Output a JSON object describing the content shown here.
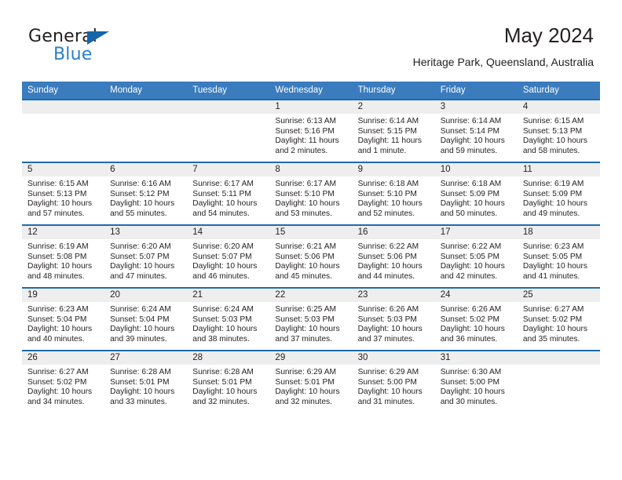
{
  "brand": {
    "word_one": "General",
    "word_two": "Blue",
    "triangle_color": "#1565a8",
    "blue_color": "#2a7fc9"
  },
  "header": {
    "title": "May 2024",
    "subtitle": "Heritage Park, Queensland, Australia"
  },
  "theme": {
    "header_bar": "#3a7cbe",
    "row_rule": "#1f6bb0",
    "daynum_band": "#eeeeee",
    "text": "#231f20"
  },
  "weekday_headers": [
    "Sunday",
    "Monday",
    "Tuesday",
    "Wednesday",
    "Thursday",
    "Friday",
    "Saturday"
  ],
  "labels": {
    "sunrise_prefix": "Sunrise:",
    "sunset_prefix": "Sunset:",
    "daylight_prefix": "Daylight:"
  },
  "weeks": [
    [
      {
        "day": "",
        "sunrise": "",
        "sunset": "",
        "daylight": "",
        "empty": true
      },
      {
        "day": "",
        "sunrise": "",
        "sunset": "",
        "daylight": "",
        "empty": true
      },
      {
        "day": "",
        "sunrise": "",
        "sunset": "",
        "daylight": "",
        "empty": true
      },
      {
        "day": "1",
        "sunrise": "Sunrise: 6:13 AM",
        "sunset": "Sunset: 5:16 PM",
        "daylight": "Daylight: 11 hours and 2 minutes."
      },
      {
        "day": "2",
        "sunrise": "Sunrise: 6:14 AM",
        "sunset": "Sunset: 5:15 PM",
        "daylight": "Daylight: 11 hours and 1 minute."
      },
      {
        "day": "3",
        "sunrise": "Sunrise: 6:14 AM",
        "sunset": "Sunset: 5:14 PM",
        "daylight": "Daylight: 10 hours and 59 minutes."
      },
      {
        "day": "4",
        "sunrise": "Sunrise: 6:15 AM",
        "sunset": "Sunset: 5:13 PM",
        "daylight": "Daylight: 10 hours and 58 minutes."
      }
    ],
    [
      {
        "day": "5",
        "sunrise": "Sunrise: 6:15 AM",
        "sunset": "Sunset: 5:13 PM",
        "daylight": "Daylight: 10 hours and 57 minutes."
      },
      {
        "day": "6",
        "sunrise": "Sunrise: 6:16 AM",
        "sunset": "Sunset: 5:12 PM",
        "daylight": "Daylight: 10 hours and 55 minutes."
      },
      {
        "day": "7",
        "sunrise": "Sunrise: 6:17 AM",
        "sunset": "Sunset: 5:11 PM",
        "daylight": "Daylight: 10 hours and 54 minutes."
      },
      {
        "day": "8",
        "sunrise": "Sunrise: 6:17 AM",
        "sunset": "Sunset: 5:10 PM",
        "daylight": "Daylight: 10 hours and 53 minutes."
      },
      {
        "day": "9",
        "sunrise": "Sunrise: 6:18 AM",
        "sunset": "Sunset: 5:10 PM",
        "daylight": "Daylight: 10 hours and 52 minutes."
      },
      {
        "day": "10",
        "sunrise": "Sunrise: 6:18 AM",
        "sunset": "Sunset: 5:09 PM",
        "daylight": "Daylight: 10 hours and 50 minutes."
      },
      {
        "day": "11",
        "sunrise": "Sunrise: 6:19 AM",
        "sunset": "Sunset: 5:09 PM",
        "daylight": "Daylight: 10 hours and 49 minutes."
      }
    ],
    [
      {
        "day": "12",
        "sunrise": "Sunrise: 6:19 AM",
        "sunset": "Sunset: 5:08 PM",
        "daylight": "Daylight: 10 hours and 48 minutes."
      },
      {
        "day": "13",
        "sunrise": "Sunrise: 6:20 AM",
        "sunset": "Sunset: 5:07 PM",
        "daylight": "Daylight: 10 hours and 47 minutes."
      },
      {
        "day": "14",
        "sunrise": "Sunrise: 6:20 AM",
        "sunset": "Sunset: 5:07 PM",
        "daylight": "Daylight: 10 hours and 46 minutes."
      },
      {
        "day": "15",
        "sunrise": "Sunrise: 6:21 AM",
        "sunset": "Sunset: 5:06 PM",
        "daylight": "Daylight: 10 hours and 45 minutes."
      },
      {
        "day": "16",
        "sunrise": "Sunrise: 6:22 AM",
        "sunset": "Sunset: 5:06 PM",
        "daylight": "Daylight: 10 hours and 44 minutes."
      },
      {
        "day": "17",
        "sunrise": "Sunrise: 6:22 AM",
        "sunset": "Sunset: 5:05 PM",
        "daylight": "Daylight: 10 hours and 42 minutes."
      },
      {
        "day": "18",
        "sunrise": "Sunrise: 6:23 AM",
        "sunset": "Sunset: 5:05 PM",
        "daylight": "Daylight: 10 hours and 41 minutes."
      }
    ],
    [
      {
        "day": "19",
        "sunrise": "Sunrise: 6:23 AM",
        "sunset": "Sunset: 5:04 PM",
        "daylight": "Daylight: 10 hours and 40 minutes."
      },
      {
        "day": "20",
        "sunrise": "Sunrise: 6:24 AM",
        "sunset": "Sunset: 5:04 PM",
        "daylight": "Daylight: 10 hours and 39 minutes."
      },
      {
        "day": "21",
        "sunrise": "Sunrise: 6:24 AM",
        "sunset": "Sunset: 5:03 PM",
        "daylight": "Daylight: 10 hours and 38 minutes."
      },
      {
        "day": "22",
        "sunrise": "Sunrise: 6:25 AM",
        "sunset": "Sunset: 5:03 PM",
        "daylight": "Daylight: 10 hours and 37 minutes."
      },
      {
        "day": "23",
        "sunrise": "Sunrise: 6:26 AM",
        "sunset": "Sunset: 5:03 PM",
        "daylight": "Daylight: 10 hours and 37 minutes."
      },
      {
        "day": "24",
        "sunrise": "Sunrise: 6:26 AM",
        "sunset": "Sunset: 5:02 PM",
        "daylight": "Daylight: 10 hours and 36 minutes."
      },
      {
        "day": "25",
        "sunrise": "Sunrise: 6:27 AM",
        "sunset": "Sunset: 5:02 PM",
        "daylight": "Daylight: 10 hours and 35 minutes."
      }
    ],
    [
      {
        "day": "26",
        "sunrise": "Sunrise: 6:27 AM",
        "sunset": "Sunset: 5:02 PM",
        "daylight": "Daylight: 10 hours and 34 minutes."
      },
      {
        "day": "27",
        "sunrise": "Sunrise: 6:28 AM",
        "sunset": "Sunset: 5:01 PM",
        "daylight": "Daylight: 10 hours and 33 minutes."
      },
      {
        "day": "28",
        "sunrise": "Sunrise: 6:28 AM",
        "sunset": "Sunset: 5:01 PM",
        "daylight": "Daylight: 10 hours and 32 minutes."
      },
      {
        "day": "29",
        "sunrise": "Sunrise: 6:29 AM",
        "sunset": "Sunset: 5:01 PM",
        "daylight": "Daylight: 10 hours and 32 minutes."
      },
      {
        "day": "30",
        "sunrise": "Sunrise: 6:29 AM",
        "sunset": "Sunset: 5:00 PM",
        "daylight": "Daylight: 10 hours and 31 minutes."
      },
      {
        "day": "31",
        "sunrise": "Sunrise: 6:30 AM",
        "sunset": "Sunset: 5:00 PM",
        "daylight": "Daylight: 10 hours and 30 minutes."
      },
      {
        "day": "",
        "sunrise": "",
        "sunset": "",
        "daylight": "",
        "empty": true
      }
    ]
  ]
}
